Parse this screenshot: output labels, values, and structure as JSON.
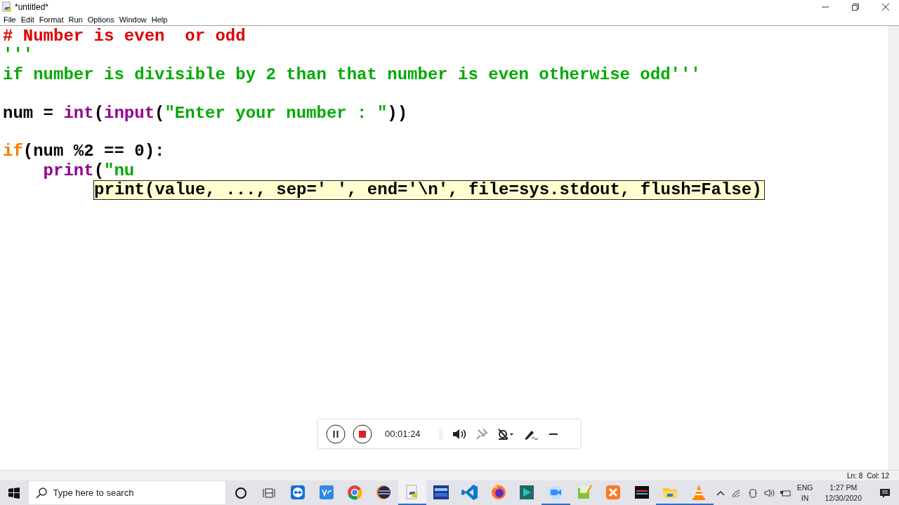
{
  "window": {
    "title": "*untitled*"
  },
  "menu": [
    "File",
    "Edit",
    "Format",
    "Run",
    "Options",
    "Window",
    "Help"
  ],
  "editor": {
    "lines": [
      {
        "kind": "code",
        "tokens": [
          {
            "kind": "comment",
            "text": "# Number is even  or odd"
          }
        ]
      },
      {
        "kind": "code",
        "tokens": [
          {
            "kind": "string",
            "text": "'''"
          }
        ]
      },
      {
        "kind": "code",
        "tokens": [
          {
            "kind": "string",
            "text": "if number is divisible by 2 than that number is even otherwise odd'''"
          }
        ]
      },
      {
        "kind": "blank"
      },
      {
        "kind": "code",
        "tokens": [
          {
            "kind": "plain",
            "text": "num = "
          },
          {
            "kind": "builtin",
            "text": "int"
          },
          {
            "kind": "plain",
            "text": "("
          },
          {
            "kind": "builtin",
            "text": "input"
          },
          {
            "kind": "plain",
            "text": "("
          },
          {
            "kind": "string",
            "text": "\"Enter your number : \""
          },
          {
            "kind": "plain",
            "text": "))"
          }
        ]
      },
      {
        "kind": "blank"
      },
      {
        "kind": "code",
        "tokens": [
          {
            "kind": "keyword",
            "text": "if"
          },
          {
            "kind": "plain",
            "text": "(num %2 == 0):"
          }
        ]
      },
      {
        "kind": "code",
        "tokens": [
          {
            "kind": "builtin",
            "text": "    print"
          },
          {
            "kind": "plain",
            "text": "("
          },
          {
            "kind": "string",
            "text": "\"nu"
          }
        ]
      }
    ],
    "calltip": "print(value, ..., sep=' ', end='\\n', file=sys.stdout, flush=False)"
  },
  "status_bar": {
    "line": "Ln: 8",
    "column": "Col: 12"
  },
  "recorder": {
    "time": "00:01:24"
  },
  "taskbar": {
    "search_placeholder": "Type here to search",
    "apps": [
      {
        "kind": "arrows",
        "running": false,
        "selected": false
      },
      {
        "kind": "vnc",
        "running": false,
        "selected": false
      },
      {
        "kind": "chrome",
        "running": false,
        "selected": false
      },
      {
        "kind": "eclipse",
        "running": false,
        "selected": false
      },
      {
        "kind": "python",
        "running": true,
        "selected": true
      },
      {
        "kind": "dev",
        "running": false,
        "selected": false
      },
      {
        "kind": "vscode",
        "running": false,
        "selected": false
      },
      {
        "kind": "firefox",
        "running": false,
        "selected": false
      },
      {
        "kind": "film",
        "running": false,
        "selected": false
      },
      {
        "kind": "camera",
        "running": true,
        "selected": false
      },
      {
        "kind": "notepad",
        "running": false,
        "selected": false
      },
      {
        "kind": "xampp",
        "running": false,
        "selected": false
      },
      {
        "kind": "logo",
        "running": false,
        "selected": false
      },
      {
        "kind": "folder",
        "running": true,
        "selected": false
      },
      {
        "kind": "cone",
        "running": true,
        "selected": false
      }
    ],
    "language": "ENG",
    "region": "IN",
    "time": "1:27 PM",
    "date": "12/30/2020"
  }
}
